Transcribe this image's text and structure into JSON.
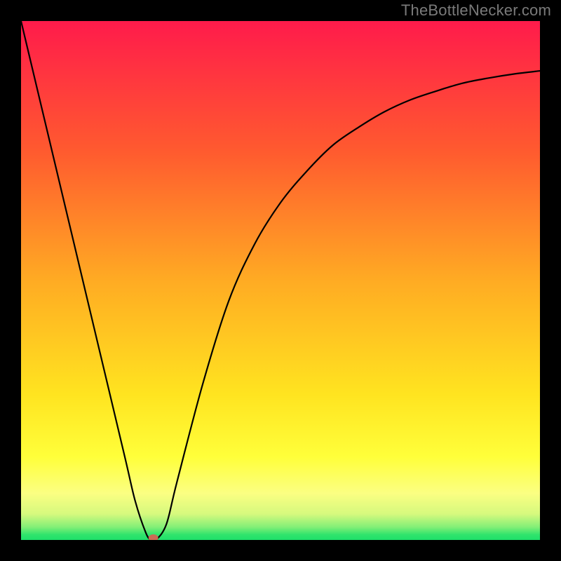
{
  "attribution": "TheBottleNecker.com",
  "colors": {
    "top": "#ff1b4b",
    "mid_upper": "#ff7e27",
    "mid": "#ffd21f",
    "mid_lower": "#ffff33",
    "bottom": "#1fe06a",
    "curve": "#000000",
    "marker": "#cc6b55",
    "background": "#000000"
  },
  "chart_data": {
    "type": "line",
    "title": "",
    "xlabel": "",
    "ylabel": "",
    "xlim": [
      0,
      100
    ],
    "ylim": [
      0,
      100
    ],
    "series": [
      {
        "name": "v-curve",
        "x": [
          0,
          5,
          10,
          15,
          20,
          22,
          24,
          25,
          26,
          28,
          30,
          35,
          40,
          45,
          50,
          55,
          60,
          65,
          70,
          75,
          80,
          85,
          90,
          95,
          100
        ],
        "y": [
          100,
          79,
          58,
          37,
          16,
          7.5,
          1.5,
          0,
          0,
          3,
          11,
          30,
          46,
          57,
          65,
          71,
          76,
          79.5,
          82.5,
          84.8,
          86.5,
          88,
          89,
          89.8,
          90.4
        ]
      }
    ],
    "annotations": [
      {
        "name": "trough-marker",
        "x": 25.5,
        "y": 0,
        "shape": "oval",
        "color": "#cc6b55"
      }
    ],
    "gradient_bands": [
      {
        "y0": 100,
        "y1": 24,
        "from": "#ff1b4b",
        "to": "#ffd21f"
      },
      {
        "y0": 24,
        "y1": 10,
        "from": "#ffd21f",
        "to": "#ffff33"
      },
      {
        "y0": 10,
        "y1": 4,
        "from": "#ffff8a",
        "to": "#eafc8f"
      },
      {
        "y0": 4,
        "y1": 1,
        "from": "#c4f57b",
        "to": "#4beb73"
      },
      {
        "y0": 1,
        "y1": 0,
        "from": "#1fe06a",
        "to": "#1fe06a"
      }
    ]
  }
}
